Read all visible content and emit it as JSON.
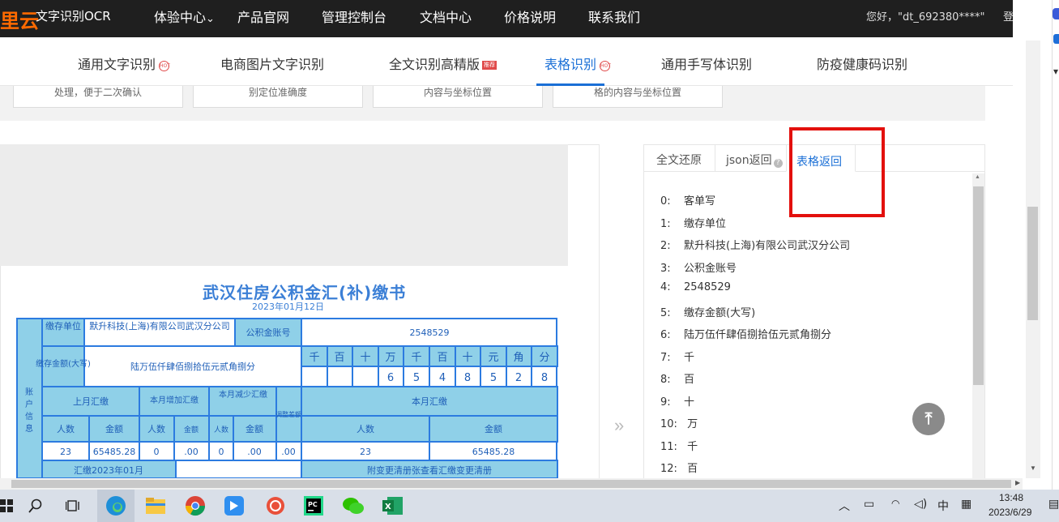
{
  "topnav": {
    "logo": "里云",
    "product": "文字识别OCR",
    "items": [
      "体验中心",
      "产品官网",
      "管理控制台",
      "文档中心",
      "价格说明",
      "联系我们"
    ],
    "caret": "⌄",
    "greeting": "您好，\"dt_692380****\"",
    "login": "登出"
  },
  "tabs": [
    {
      "label": "通用文字识别",
      "badge": "HOT"
    },
    {
      "label": "电商图片文字识别"
    },
    {
      "label": "全文识别高精版",
      "badge": "推荐"
    },
    {
      "label": "表格识别",
      "badge": "HOT"
    },
    {
      "label": "通用手写体识别"
    },
    {
      "label": "防疫健康码识别"
    }
  ],
  "feature_cards": [
    "处理，便于二次确认",
    "别定位准确度",
    "内容与坐标位置",
    "格的内容与坐标位置"
  ],
  "document": {
    "title": "武汉住房公积金汇(补)缴书",
    "date": "2023年01月12日",
    "payer_label": "缴存单位",
    "payer_value": "默升科技(上海)有限公司武汉分公司",
    "account_label": "公积金账号",
    "account_value": "2548529",
    "amount_label": "缴存金额(大写)",
    "amount_value": "陆万伍仟肆佰捌拾伍元贰角捌分",
    "digit_headers": [
      "千",
      "百",
      "十",
      "万",
      "千",
      "百",
      "十",
      "元",
      "角",
      "分"
    ],
    "digits": [
      "",
      "",
      "",
      "6",
      "5",
      "4",
      "8",
      "5",
      "2",
      "8"
    ],
    "side_label": "账户信息",
    "side_label_chars": [
      "账",
      "户",
      "信",
      "息"
    ],
    "prev_month": "上月汇缴",
    "add_month": "本月增加汇缴",
    "sub_month": "本月减少汇缴",
    "adjust": "调整差额",
    "cur_month": "本月汇缴",
    "people": "人数",
    "amount": "金额",
    "row_values": [
      "23",
      "65485.28",
      "0",
      ".00",
      "0",
      ".00",
      ".00",
      "23",
      "65485.28"
    ],
    "footer_left": "汇缴2023年01月",
    "footer_right": "附变更清册张查看汇缴变更清册"
  },
  "result": {
    "tabs": [
      "全文还原",
      "json返回",
      "表格返回"
    ],
    "help_icon": "?",
    "rows": [
      {
        "idx": "0:",
        "text": "客单写"
      },
      {
        "idx": "1:",
        "text": "缴存单位"
      },
      {
        "idx": "2:",
        "text": "默升科技(上海)有限公司武汉分公司"
      },
      {
        "idx": "3:",
        "text": "公积金账号"
      },
      {
        "idx": "4:",
        "text": "2548529"
      },
      {
        "idx": "5:",
        "text": "缴存金额(大写)"
      },
      {
        "idx": "6:",
        "text": "陆万伍仟肆佰捌拾伍元贰角捌分"
      },
      {
        "idx": "7:",
        "text": "千"
      },
      {
        "idx": "8:",
        "text": "百"
      },
      {
        "idx": "9:",
        "text": "十"
      },
      {
        "idx": "10:",
        "text": " 万"
      },
      {
        "idx": "11:",
        "text": " 千"
      },
      {
        "idx": "12:",
        "text": " 百"
      }
    ]
  },
  "taskbar": {
    "ime": "中",
    "time": "13:48",
    "date": "2023/6/29"
  },
  "colors": {
    "accent": "#1a6fd6",
    "brand": "#ff6a00",
    "highlight": "#e3100d"
  }
}
